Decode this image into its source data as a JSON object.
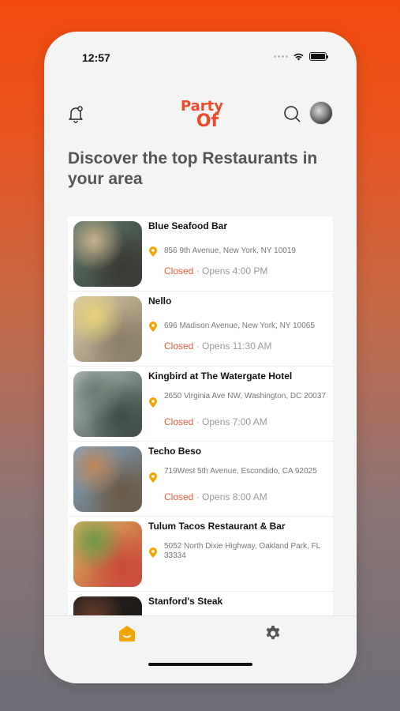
{
  "status_bar": {
    "time": "12:57"
  },
  "header": {
    "logo_line1": "Party",
    "logo_line2": "Of"
  },
  "headline": "Discover the top Restaurants in your area",
  "restaurants": [
    {
      "name": "Blue Seafood Bar",
      "address": "856 9th Avenue, New York, NY 10019",
      "status": "Closed",
      "opens": "· Opens 4:00 PM",
      "colors": [
        "#5b7a6a",
        "#c9b08a",
        "#3b3a35"
      ]
    },
    {
      "name": "Nello",
      "address": "696 Madison Avenue, New York, NY 10065",
      "status": "Closed",
      "opens": "· Opens 11:30 AM",
      "colors": [
        "#d8c9a8",
        "#e6d27a",
        "#8c7f68"
      ]
    },
    {
      "name": "Kingbird at The Watergate Hotel",
      "address": "2650 Virginia Ave NW, Washington, DC 20037",
      "status": "Closed",
      "opens": "· Opens 7:00 AM",
      "colors": [
        "#b9c4be",
        "#6b7a72",
        "#3e4a44"
      ]
    },
    {
      "name": "Techo Beso",
      "address": "719West 5th Avenue, Escondido, CA 92025",
      "status": "Closed",
      "opens": "· Opens 8:00 AM",
      "colors": [
        "#7fa8cc",
        "#c0875a",
        "#6a5a46"
      ]
    },
    {
      "name": "Tulum Tacos Restaurant & Bar",
      "address": "5052 North Dixie Highway, Oakland Park, FL 33334",
      "status": "",
      "opens": "",
      "colors": [
        "#d8b35e",
        "#6f9a4a",
        "#c94a3a"
      ]
    },
    {
      "name": "Stanford's Steak",
      "address": "",
      "status": "",
      "opens": "",
      "colors": [
        "#2a2420",
        "#6b3b2a",
        "#1a1614"
      ]
    }
  ],
  "accent_color": "#ec4a2a",
  "pin_color": "#f0a500",
  "icons": {
    "bell": "bell-icon",
    "search": "search-icon",
    "home": "home-icon",
    "settings": "gear-icon",
    "pin": "location-pin-icon"
  }
}
